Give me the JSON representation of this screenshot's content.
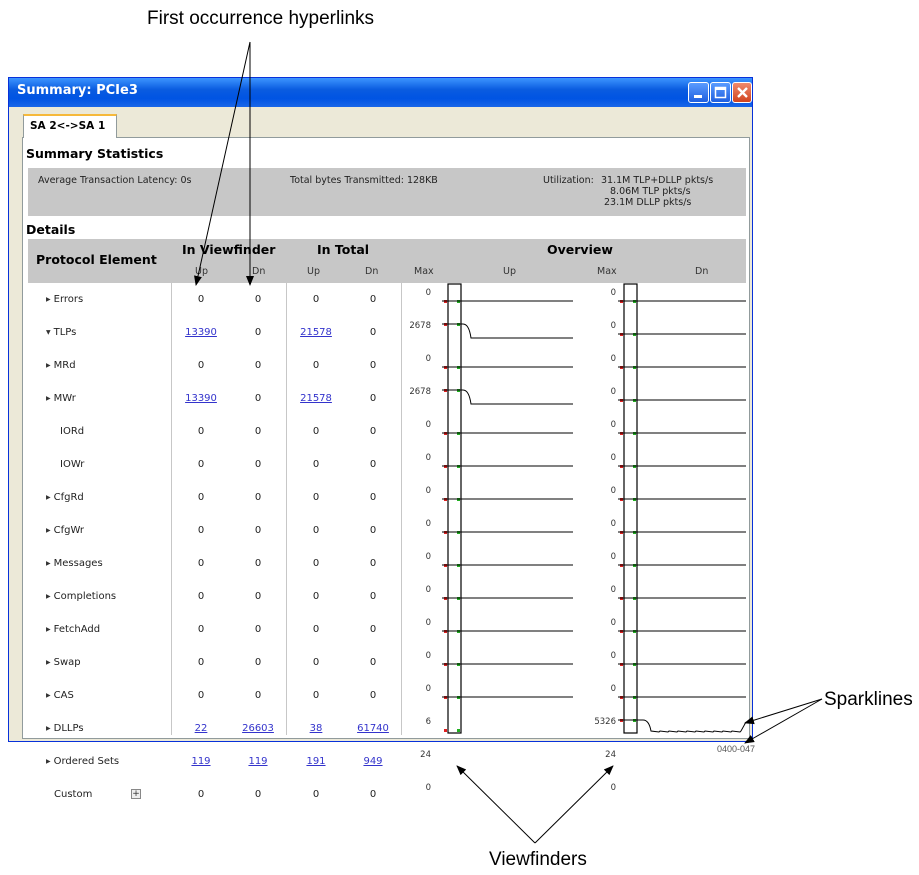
{
  "annotations": {
    "top": "First occurrence hyperlinks",
    "right": "Sparklines",
    "bottom": "Viewfinders",
    "figure_id": "0400-047"
  },
  "window": {
    "title": "Summary: PCIe3"
  },
  "tab": {
    "label": "SA 2<->SA 1"
  },
  "summary": {
    "title": "Summary Statistics",
    "latency": "Average Transaction Latency: 0s",
    "bytes": "Total bytes Transmitted: 128KB",
    "utilization_label": "Utilization:",
    "utilization_lines": [
      "31.1M TLP+DLLP pkts/s",
      "8.06M TLP pkts/s",
      "23.1M DLLP pkts/s"
    ]
  },
  "details": {
    "title": "Details",
    "headers": {
      "protocol_element": "Protocol Element",
      "in_viewfinder": "In Viewfinder",
      "in_total": "In Total",
      "overview": "Overview",
      "up": "Up",
      "dn": "Dn",
      "max": "Max"
    },
    "rows": [
      {
        "label": "Errors",
        "expander": "collapsed",
        "vf_up": "0",
        "vf_dn": "0",
        "tot_up": "0",
        "tot_dn": "0",
        "max_up": "0",
        "max_dn": "0",
        "spark_up": "flat",
        "spark_dn": "flat"
      },
      {
        "label": "TLPs",
        "expander": "expanded",
        "vf_up": "13390",
        "vf_up_link": true,
        "vf_dn": "0",
        "tot_up": "21578",
        "tot_up_link": true,
        "tot_dn": "0",
        "max_up": "2678",
        "max_dn": "0",
        "spark_up": "drop",
        "spark_dn": "flat"
      },
      {
        "label": "MRd",
        "expander": "collapsed",
        "indent": true,
        "vf_up": "0",
        "vf_dn": "0",
        "tot_up": "0",
        "tot_dn": "0",
        "max_up": "0",
        "max_dn": "0",
        "spark_up": "flat",
        "spark_dn": "flat"
      },
      {
        "label": "MWr",
        "expander": "collapsed",
        "indent": true,
        "vf_up": "13390",
        "vf_up_link": true,
        "vf_dn": "0",
        "tot_up": "21578",
        "tot_up_link": true,
        "tot_dn": "0",
        "max_up": "2678",
        "max_dn": "0",
        "spark_up": "drop",
        "spark_dn": "flat"
      },
      {
        "label": "IORd",
        "expander": "none",
        "indent": true,
        "vf_up": "0",
        "vf_dn": "0",
        "tot_up": "0",
        "tot_dn": "0",
        "max_up": "0",
        "max_dn": "0",
        "spark_up": "flat",
        "spark_dn": "flat"
      },
      {
        "label": "IOWr",
        "expander": "none",
        "indent": true,
        "vf_up": "0",
        "vf_dn": "0",
        "tot_up": "0",
        "tot_dn": "0",
        "max_up": "0",
        "max_dn": "0",
        "spark_up": "flat",
        "spark_dn": "flat"
      },
      {
        "label": "CfgRd",
        "expander": "collapsed",
        "indent": true,
        "vf_up": "0",
        "vf_dn": "0",
        "tot_up": "0",
        "tot_dn": "0",
        "max_up": "0",
        "max_dn": "0",
        "spark_up": "flat",
        "spark_dn": "flat"
      },
      {
        "label": "CfgWr",
        "expander": "collapsed",
        "indent": true,
        "vf_up": "0",
        "vf_dn": "0",
        "tot_up": "0",
        "tot_dn": "0",
        "max_up": "0",
        "max_dn": "0",
        "spark_up": "flat",
        "spark_dn": "flat"
      },
      {
        "label": "Messages",
        "expander": "collapsed",
        "indent": true,
        "vf_up": "0",
        "vf_dn": "0",
        "tot_up": "0",
        "tot_dn": "0",
        "max_up": "0",
        "max_dn": "0",
        "spark_up": "flat",
        "spark_dn": "flat"
      },
      {
        "label": "Completions",
        "expander": "collapsed",
        "indent": true,
        "vf_up": "0",
        "vf_dn": "0",
        "tot_up": "0",
        "tot_dn": "0",
        "max_up": "0",
        "max_dn": "0",
        "spark_up": "flat",
        "spark_dn": "flat"
      },
      {
        "label": "FetchAdd",
        "expander": "collapsed",
        "indent": true,
        "vf_up": "0",
        "vf_dn": "0",
        "tot_up": "0",
        "tot_dn": "0",
        "max_up": "0",
        "max_dn": "0",
        "spark_up": "flat",
        "spark_dn": "flat"
      },
      {
        "label": "Swap",
        "expander": "collapsed",
        "indent": true,
        "vf_up": "0",
        "vf_dn": "0",
        "tot_up": "0",
        "tot_dn": "0",
        "max_up": "0",
        "max_dn": "0",
        "spark_up": "flat",
        "spark_dn": "flat"
      },
      {
        "label": "CAS",
        "expander": "collapsed",
        "indent": true,
        "vf_up": "0",
        "vf_dn": "0",
        "tot_up": "0",
        "tot_dn": "0",
        "max_up": "0",
        "max_dn": "0",
        "spark_up": "flat",
        "spark_dn": "flat"
      },
      {
        "label": "DLLPs",
        "expander": "collapsed",
        "vf_up": "22",
        "vf_up_link": true,
        "vf_dn": "26603",
        "vf_dn_link": true,
        "tot_up": "38",
        "tot_up_link": true,
        "tot_dn": "61740",
        "tot_dn_link": true,
        "max_up": "6",
        "max_dn": "5326",
        "spark_up": "flat_low",
        "spark_dn": "wave"
      },
      {
        "label": "Ordered Sets",
        "expander": "collapsed",
        "vf_up": "119",
        "vf_up_link": true,
        "vf_dn": "119",
        "vf_dn_link": true,
        "tot_up": "191",
        "tot_up_link": true,
        "tot_dn": "949",
        "tot_dn_link": true,
        "max_up": "24",
        "max_dn": "24",
        "spark_up": "drop",
        "spark_dn": "dashed"
      },
      {
        "label": "Custom",
        "expander": "none",
        "custom": true,
        "vf_up": "0",
        "vf_dn": "0",
        "tot_up": "0",
        "tot_dn": "0",
        "max_up": "0",
        "max_dn": "0",
        "spark_up": "none",
        "spark_dn": "none"
      }
    ]
  },
  "colors": {
    "title_bar": "#0054e3",
    "header_bg": "#c7c7c7",
    "link": "#3333cc",
    "marker_red": "#e02020",
    "marker_green": "#20b020"
  }
}
